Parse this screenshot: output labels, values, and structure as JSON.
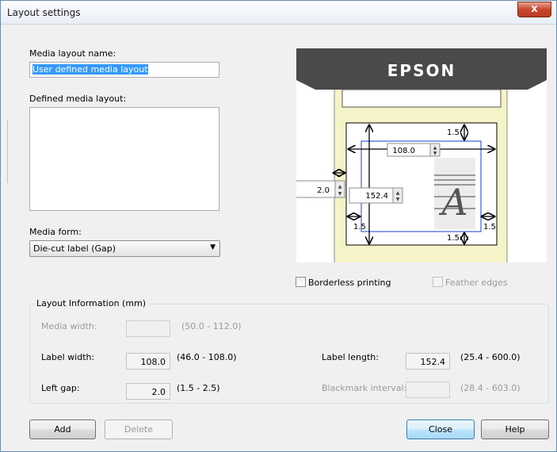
{
  "window": {
    "title": "Layout settings",
    "close_glyph": "x"
  },
  "media_layout_name": {
    "label": "Media layout name:",
    "value": "User defined media layout"
  },
  "defined_media_layout": {
    "label": "Defined media layout:"
  },
  "media_form": {
    "label": "Media form:",
    "selected": "Die-cut label (Gap)"
  },
  "preview": {
    "brand": "EPSON",
    "top_margin": "1.5",
    "label_width": "108.0",
    "left_gap": "2.0",
    "label_length": "152.4",
    "left_margin": "1.5",
    "right_margin": "1.5",
    "bottom_margin": "1.5",
    "glyph": "A"
  },
  "borderless_printing": {
    "label": "Borderless printing",
    "checked": false
  },
  "feather_edges": {
    "label": "Feather edges",
    "checked": false,
    "enabled": false
  },
  "layout_info": {
    "title": "Layout Information (mm)",
    "media_width": {
      "label": "Media width:",
      "value": "",
      "range": "(50.0 - 112.0)"
    },
    "label_width": {
      "label": "Label width:",
      "value": "108.0",
      "range": "(46.0 - 108.0)"
    },
    "left_gap": {
      "label": "Left gap:",
      "value": "2.0",
      "range": "(1.5 - 2.5)"
    },
    "label_length": {
      "label": "Label length:",
      "value": "152.4",
      "range": "(25.4 - 600.0)"
    },
    "blackmark_interval": {
      "label": "Blackmark interval:",
      "value": "",
      "range": "(28.4 - 603.0)"
    }
  },
  "buttons": {
    "add": "Add",
    "delete": "Delete",
    "close": "Close",
    "help": "Help"
  },
  "colors": {
    "accent": "#3399ff",
    "label_frame": "#3f5fdc",
    "paper": "#f5f3c8",
    "printer": "#4a4a4a"
  }
}
